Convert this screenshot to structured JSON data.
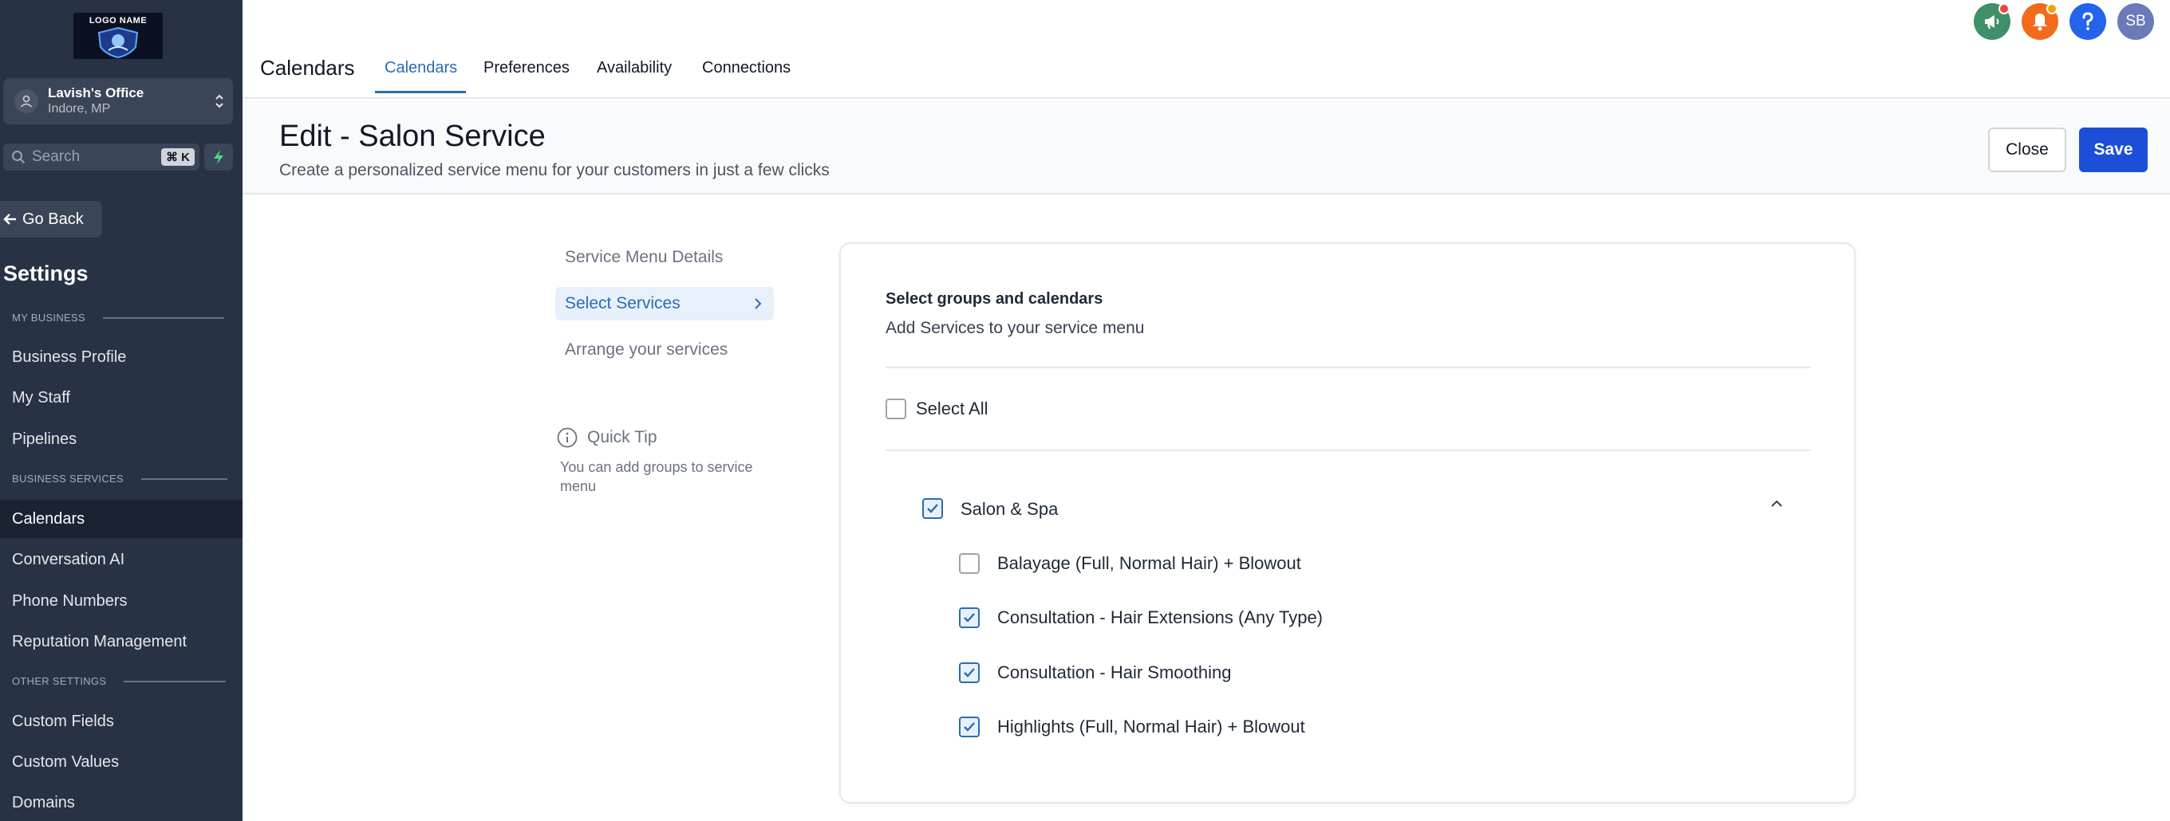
{
  "sidebar": {
    "logo_text": "LOGO NAME",
    "location": {
      "name": "Lavish's Office",
      "sub": "Indore, MP"
    },
    "search": {
      "placeholder": "Search",
      "shortcut": "⌘ K"
    },
    "go_back": "Go Back",
    "settings_title": "Settings",
    "sections": [
      {
        "label": "MY BUSINESS",
        "items": [
          "Business Profile",
          "My Staff",
          "Pipelines"
        ]
      },
      {
        "label": "BUSINESS SERVICES",
        "items": [
          "Calendars",
          "Conversation AI",
          "Phone Numbers",
          "Reputation Management"
        ]
      },
      {
        "label": "OTHER SETTINGS",
        "items": [
          "Custom Fields",
          "Custom Values",
          "Domains"
        ]
      }
    ],
    "active_item": "Calendars"
  },
  "topbar": {
    "title": "Calendars",
    "tabs": [
      "Calendars",
      "Preferences",
      "Availability",
      "Connections"
    ],
    "active_tab": "Calendars",
    "avatar_initials": "SB",
    "icon_colors": {
      "announce": "#3f8f6b",
      "bell": "#f26b1d",
      "help": "#2563eb",
      "avatar": "#6b7ab8"
    }
  },
  "header": {
    "title": "Edit - Salon Service",
    "subtitle": "Create a personalized service menu for your customers in just a few clicks",
    "close_label": "Close",
    "save_label": "Save"
  },
  "steps": [
    "Service Menu Details",
    "Select Services",
    "Arrange your services"
  ],
  "active_step": "Select Services",
  "tip": {
    "title": "Quick Tip",
    "body": "You can add groups to service menu"
  },
  "card": {
    "title": "Select groups and calendars",
    "subtitle": "Add Services to your service menu",
    "select_all": {
      "label": "Select All",
      "checked": false
    },
    "group": {
      "name": "Salon & Spa",
      "checked": true,
      "expanded": true,
      "services": [
        {
          "name": "Balayage (Full, Normal Hair) + Blowout",
          "checked": false
        },
        {
          "name": "Consultation - Hair Extensions (Any Type)",
          "checked": true
        },
        {
          "name": "Consultation - Hair Smoothing",
          "checked": true
        },
        {
          "name": "Highlights (Full, Normal Hair) + Blowout",
          "checked": true
        }
      ]
    }
  }
}
